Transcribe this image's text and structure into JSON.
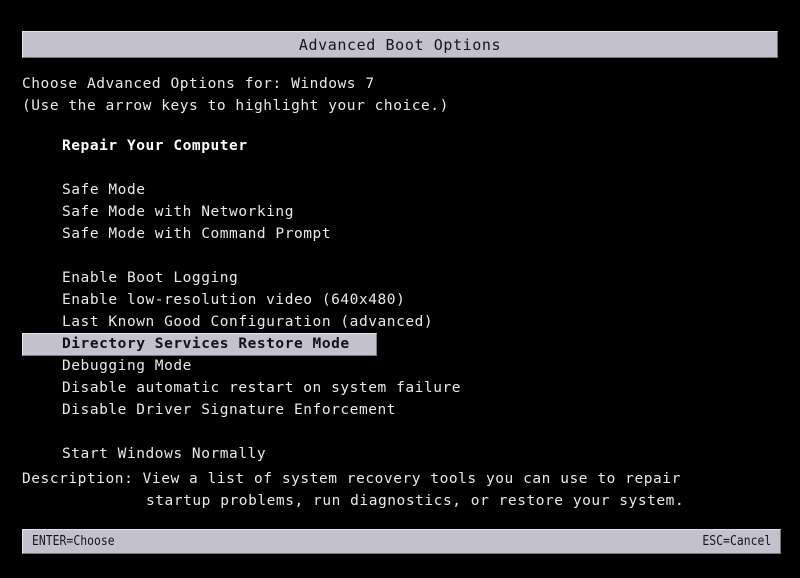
{
  "screen": {
    "background_color": "#000000",
    "foreground_color": "#e9e9e9",
    "panel_color": "#c3c1cd",
    "panel_text_color": "#16151a"
  },
  "title_bar": {
    "title": "Advanced Boot Options"
  },
  "prompt": {
    "line1": "Choose Advanced Options for: Windows 7",
    "line2": "(Use the arrow keys to highlight your choice.)"
  },
  "menu": {
    "selected_index": 8,
    "items": [
      {
        "label": "Repair Your Computer",
        "style": "bold",
        "spacer_after": true
      },
      {
        "label": "Safe Mode",
        "style": "normal",
        "spacer_after": false
      },
      {
        "label": "Safe Mode with Networking",
        "style": "normal",
        "spacer_after": false
      },
      {
        "label": "Safe Mode with Command Prompt",
        "style": "normal",
        "spacer_after": true
      },
      {
        "label": "Enable Boot Logging",
        "style": "normal",
        "spacer_after": false
      },
      {
        "label": "Enable low-resolution video (640x480)",
        "style": "normal",
        "spacer_after": false
      },
      {
        "label": "Last Known Good Configuration (advanced)",
        "style": "normal",
        "spacer_after": false
      },
      {
        "label": "Directory Services Restore Mode",
        "style": "selected",
        "spacer_after": false
      },
      {
        "label": "Debugging Mode",
        "style": "normal",
        "spacer_after": false
      },
      {
        "label": "Disable automatic restart on system failure",
        "style": "normal",
        "spacer_after": false
      },
      {
        "label": "Disable Driver Signature Enforcement",
        "style": "normal",
        "spacer_after": true
      },
      {
        "label": "Start Windows Normally",
        "style": "normal",
        "spacer_after": false
      }
    ]
  },
  "description": {
    "line1": "Description: View a list of system recovery tools you can use to repair",
    "line2": "startup problems, run diagnostics, or restore your system."
  },
  "status_bar": {
    "left": "ENTER=Choose",
    "right": "ESC=Cancel"
  }
}
